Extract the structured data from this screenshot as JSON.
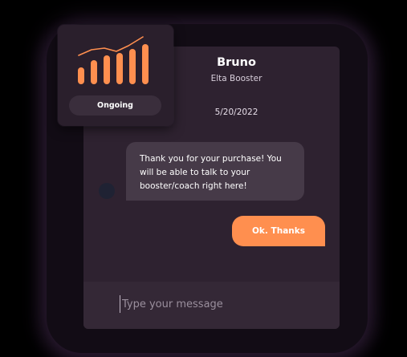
{
  "contact": {
    "name": "Bruno",
    "role": "Elta Booster"
  },
  "conversation": {
    "date": "5/20/2022",
    "messages": [
      {
        "direction": "incoming",
        "text": "Thank you for your purchase! You will be able to talk to your booster/coach right here!"
      },
      {
        "direction": "outgoing",
        "text": "Ok. Thanks"
      }
    ]
  },
  "composer": {
    "value": "",
    "placeholder": "Type your message"
  },
  "status_card": {
    "status": "Ongoing",
    "icon": "bar-chart-trend-icon",
    "bar_levels": [
      0.42,
      0.6,
      0.72,
      0.78,
      0.88,
      1.0
    ]
  },
  "colors": {
    "accent": "#ff8f4f",
    "window_bg": "#2e2230",
    "incoming_bubble": "#463a48",
    "composer_bg": "#342836",
    "card_bg": "#2a1f2c"
  }
}
